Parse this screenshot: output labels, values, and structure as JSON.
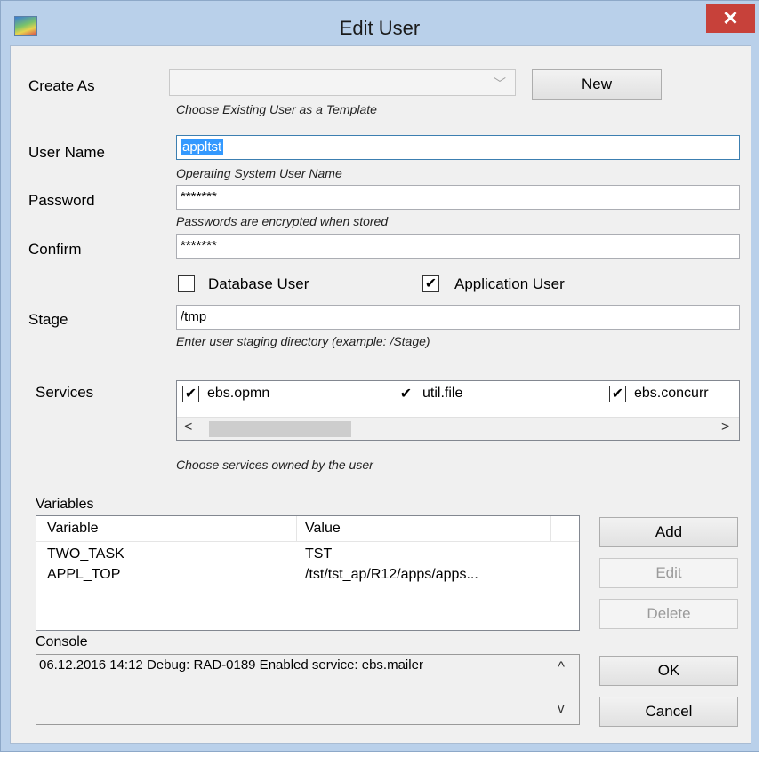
{
  "window": {
    "title": "Edit User",
    "close_glyph": "✕"
  },
  "create_as": {
    "label": "Create As",
    "value": "",
    "dropdown_glyph": "﹀",
    "hint": "Choose Existing User as a Template",
    "new_button": "New"
  },
  "user_name": {
    "label": "User Name",
    "value": "appltst",
    "hint": "Operating System User Name"
  },
  "password": {
    "label": "Password",
    "value": "*******",
    "hint": "Passwords are encrypted when stored"
  },
  "confirm": {
    "label": "Confirm",
    "value": "*******"
  },
  "user_types": {
    "database_user": {
      "label": "Database User",
      "checked": false,
      "mark": ""
    },
    "application_user": {
      "label": "Application User",
      "checked": true,
      "mark": "✔"
    }
  },
  "stage": {
    "label": "Stage",
    "value": "/tmp",
    "hint": "Enter user staging directory (example: /Stage)"
  },
  "services": {
    "label": "Services",
    "items": [
      {
        "label": "ebs.opmn",
        "checked": true,
        "mark": "✔"
      },
      {
        "label": "util.file",
        "checked": true,
        "mark": "✔"
      },
      {
        "label": "ebs.concurr",
        "checked": true,
        "mark": "✔"
      }
    ],
    "scroll_left": "<",
    "scroll_right": ">",
    "hint": "Choose services owned by the user"
  },
  "variables": {
    "label": "Variables",
    "columns": [
      "Variable",
      "Value"
    ],
    "rows": [
      {
        "variable": "TWO_TASK",
        "value": "TST"
      },
      {
        "variable": "APPL_TOP",
        "value": "/tst/tst_ap/R12/apps/apps..."
      }
    ],
    "add_button": "Add",
    "edit_button": "Edit",
    "delete_button": "Delete"
  },
  "console": {
    "label": "Console",
    "text": "06.12.2016 14:12 Debug: RAD-0189 Enabled service: ebs.mailer",
    "scroll_up": "^",
    "scroll_down": "v"
  },
  "actions": {
    "ok_button": "OK",
    "cancel_button": "Cancel"
  },
  "colors": {
    "frame": "#b9d0ea",
    "close_button": "#c7413a",
    "selection": "#3399ff",
    "dialog_bg": "#f0f0f0"
  }
}
